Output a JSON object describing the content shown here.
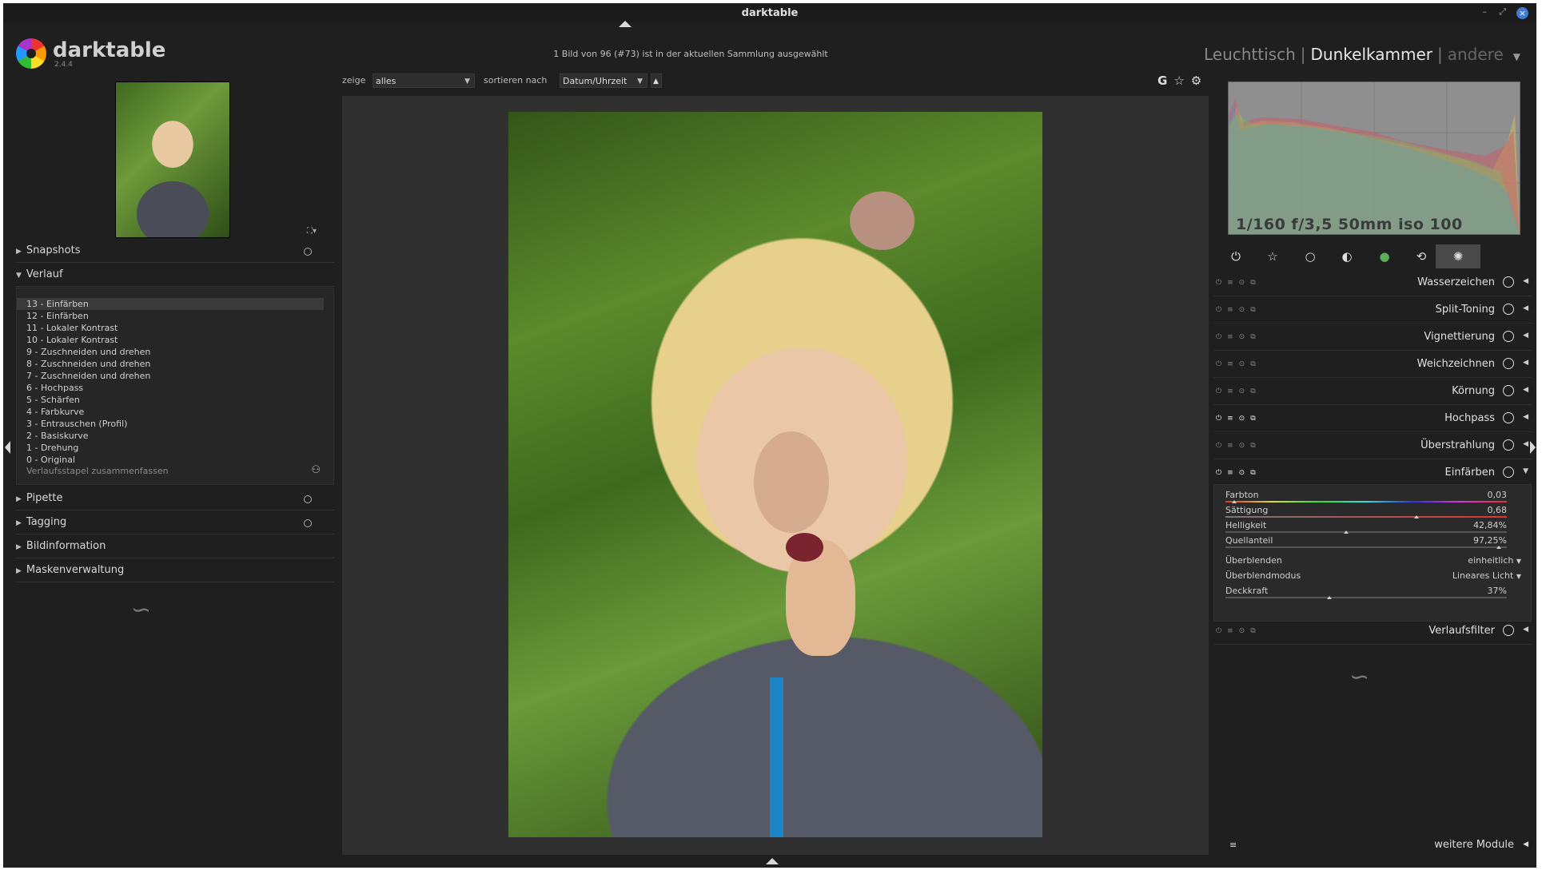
{
  "window": {
    "title": "darktable"
  },
  "app": {
    "name": "darktable",
    "version": "2.4.4"
  },
  "status_message": "1 Bild von 96 (#73) ist in der aktuellen Sammlung ausgewählt",
  "views": {
    "lighttable": "Leuchttisch",
    "darkroom": "Dunkelkammer",
    "other": "andere",
    "active": "darkroom"
  },
  "filterbar": {
    "show_label": "zeige",
    "show_value": "alles",
    "sort_label": "sortieren nach",
    "sort_value": "Datum/Uhrzeit",
    "sort_dir": "▲",
    "grouping": "G",
    "star_icon": "star-icon",
    "settings_icon": "gear-icon"
  },
  "left_panel": {
    "snapshots": "Snapshots",
    "history_title": "Verlauf",
    "history": [
      "13 - Einfärben",
      "12 - Einfärben",
      "11 - Lokaler Kontrast",
      "10 - Lokaler Kontrast",
      "9 - Zuschneiden und drehen",
      "8 - Zuschneiden und drehen",
      "7 - Zuschneiden und drehen",
      "6 - Hochpass",
      "5 - Schärfen",
      "4 - Farbkurve",
      "3 - Entrauschen (Profil)",
      "2 - Basiskurve",
      "1 - Drehung",
      "0 - Original"
    ],
    "history_selected": 0,
    "compress": "Verlaufsstapel zusammenfassen",
    "pipette": "Pipette",
    "tagging": "Tagging",
    "image_info": "Bildinformation",
    "masks": "Maskenverwaltung"
  },
  "histogram": {
    "exif": "1/160 f/3,5 50mm iso 100"
  },
  "module_groups": [
    "power-icon",
    "star-icon",
    "circle-icon",
    "half-circle-icon",
    "color-circle-icon",
    "rotate-icon",
    "effect-icon"
  ],
  "modules": [
    {
      "name": "Wasserzeichen",
      "enabled": false
    },
    {
      "name": "Split-Toning",
      "enabled": false
    },
    {
      "name": "Vignettierung",
      "enabled": false
    },
    {
      "name": "Weichzeichnen",
      "enabled": false
    },
    {
      "name": "Körnung",
      "enabled": false
    },
    {
      "name": "Hochpass",
      "enabled": true
    },
    {
      "name": "Überstrahlung",
      "enabled": false
    },
    {
      "name": "Einfärben",
      "enabled": true,
      "expanded": true
    },
    {
      "name": "Verlaufsfilter",
      "enabled": false
    }
  ],
  "einfaerben": {
    "farbton": {
      "label": "Farbton",
      "value": "0,03",
      "level": 0.03
    },
    "saettigung": {
      "label": "Sättigung",
      "value": "0,68",
      "level": 0.68
    },
    "helligkeit": {
      "label": "Helligkeit",
      "value": "42,84%",
      "level": 0.4284
    },
    "quellanteil": {
      "label": "Quellanteil",
      "value": "97,25%",
      "level": 0.9725
    },
    "blend": {
      "label": "Überblenden",
      "value": "einheitlich"
    },
    "blendmode": {
      "label": "Überblendmodus",
      "value": "Lineares Licht"
    },
    "opacity": {
      "label": "Deckkraft",
      "value": "37%",
      "level": 0.37
    }
  },
  "more_modules": "weitere Module",
  "colors": {
    "bg": "#1f1f1f",
    "center": "#303030",
    "accent": "#3d7bd6"
  }
}
